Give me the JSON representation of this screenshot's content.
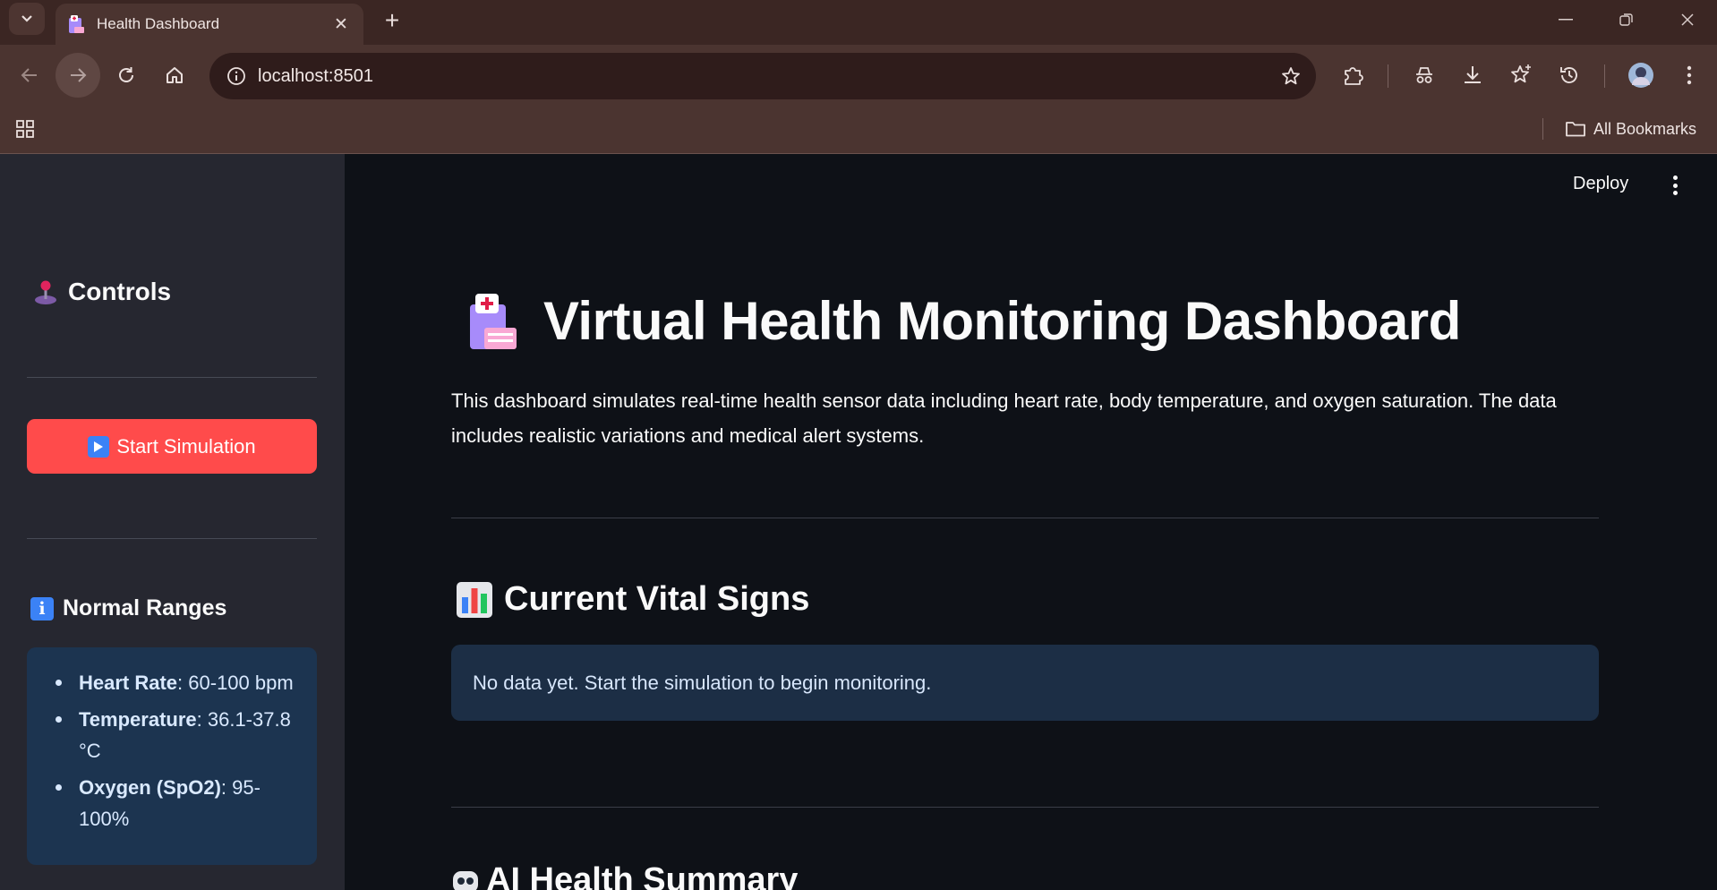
{
  "browser": {
    "tab_title": "Health Dashboard",
    "url": "localhost:8501",
    "bookmarks_label": "All Bookmarks"
  },
  "sidebar": {
    "controls_heading": "Controls",
    "start_button_label": "Start Simulation",
    "normal_ranges_heading": "Normal Ranges",
    "ranges": [
      {
        "label": "Heart Rate",
        "value": ": 60-100 bpm"
      },
      {
        "label": "Temperature",
        "value": ": 36.1-37.8 °C"
      },
      {
        "label": "Oxygen (SpO2)",
        "value": ": 95-100%"
      }
    ]
  },
  "header": {
    "deploy_label": "Deploy"
  },
  "main": {
    "title": "Virtual Health Monitoring Dashboard",
    "description": "This dashboard simulates real-time health sensor data including heart rate, body temperature, and oxygen saturation. The data includes realistic variations and medical alert systems.",
    "vitals_heading": "Current Vital Signs",
    "no_data_message": "No data yet. Start the simulation to begin monitoring.",
    "ai_summary_heading": "AI Health Summary"
  },
  "colors": {
    "primary_button": "#ff4b4b",
    "sidebar_bg": "#262730",
    "main_bg": "#0e1117",
    "info_box_bg": "#1c3450",
    "browser_frame": "#4b3430"
  },
  "icons": {
    "controls": "joystick-icon",
    "start": "play-icon",
    "normal_ranges": "info-icon",
    "title": "hospital-icon",
    "vitals": "bar-chart-icon",
    "ai_summary": "robot-icon"
  }
}
